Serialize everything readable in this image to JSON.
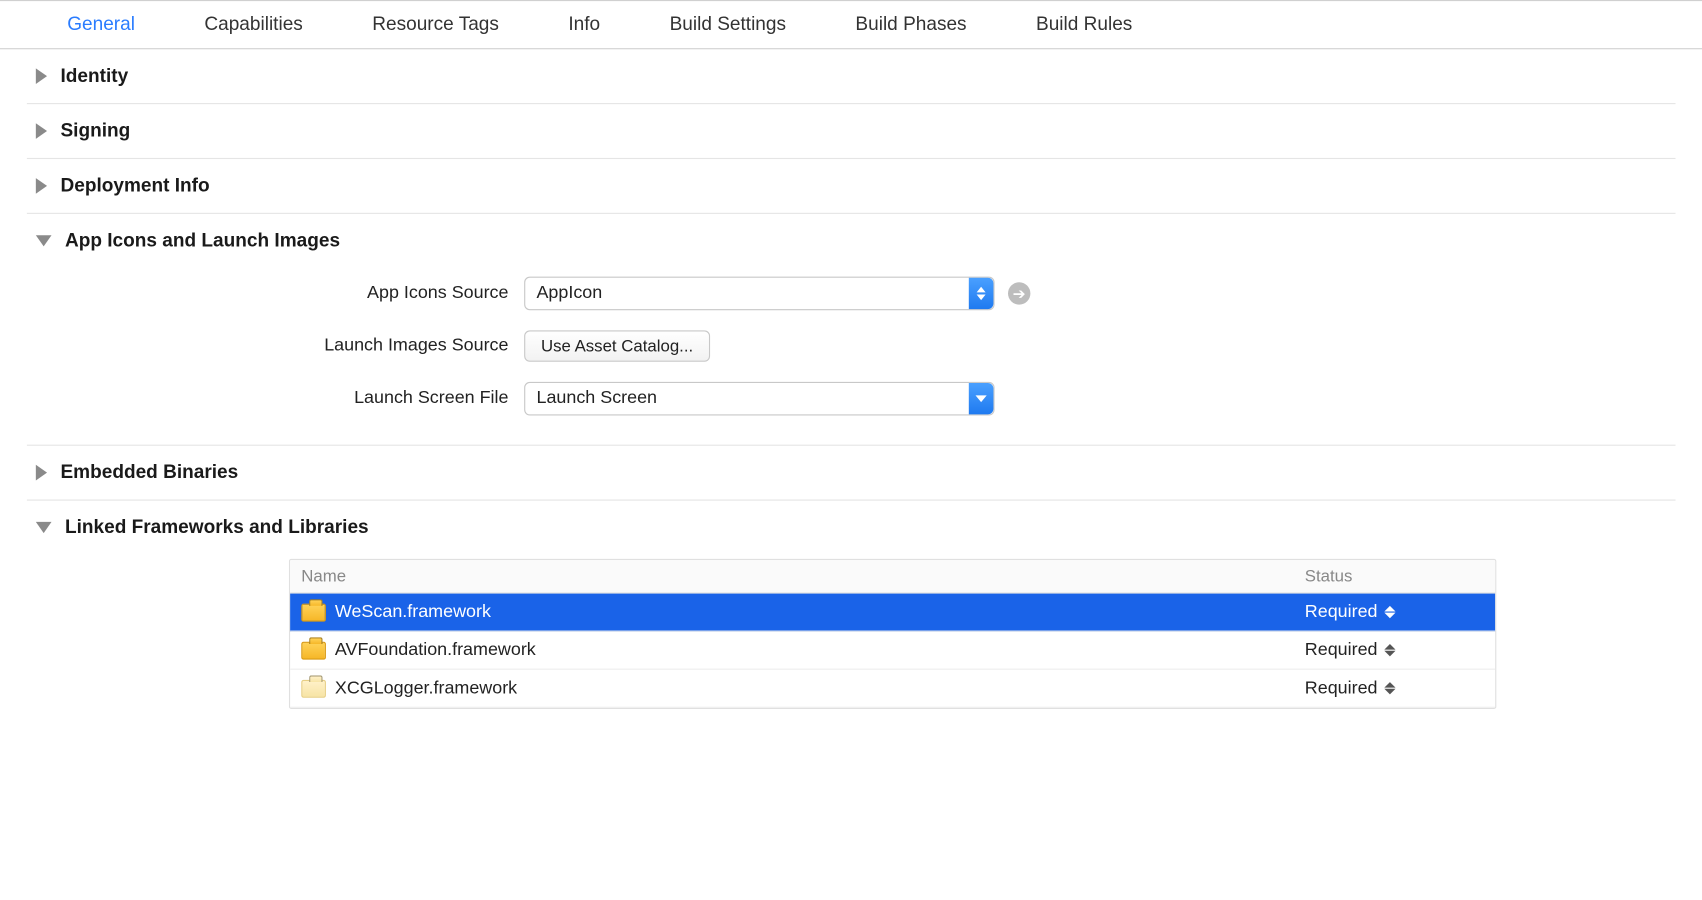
{
  "tabs": {
    "items": [
      "General",
      "Capabilities",
      "Resource Tags",
      "Info",
      "Build Settings",
      "Build Phases",
      "Build Rules"
    ],
    "active_index": 0
  },
  "sections": {
    "identity": {
      "title": "Identity",
      "expanded": false
    },
    "signing": {
      "title": "Signing",
      "expanded": false
    },
    "deployment": {
      "title": "Deployment Info",
      "expanded": false
    },
    "appicons": {
      "title": "App Icons and Launch Images",
      "expanded": true,
      "rows": {
        "app_icons_label": "App Icons Source",
        "app_icons_value": "AppIcon",
        "launch_images_label": "Launch Images Source",
        "launch_images_button": "Use Asset Catalog...",
        "launch_screen_label": "Launch Screen File",
        "launch_screen_value": "Launch Screen"
      }
    },
    "embedded": {
      "title": "Embedded Binaries",
      "expanded": false
    },
    "linked": {
      "title": "Linked Frameworks and Libraries",
      "expanded": true,
      "columns": {
        "name": "Name",
        "status": "Status"
      },
      "rows": [
        {
          "name": "WeScan.framework",
          "status": "Required",
          "tone": "yellow",
          "selected": true
        },
        {
          "name": "AVFoundation.framework",
          "status": "Required",
          "tone": "yellow",
          "selected": false
        },
        {
          "name": "XCGLogger.framework",
          "status": "Required",
          "tone": "pale",
          "selected": false
        }
      ]
    }
  }
}
